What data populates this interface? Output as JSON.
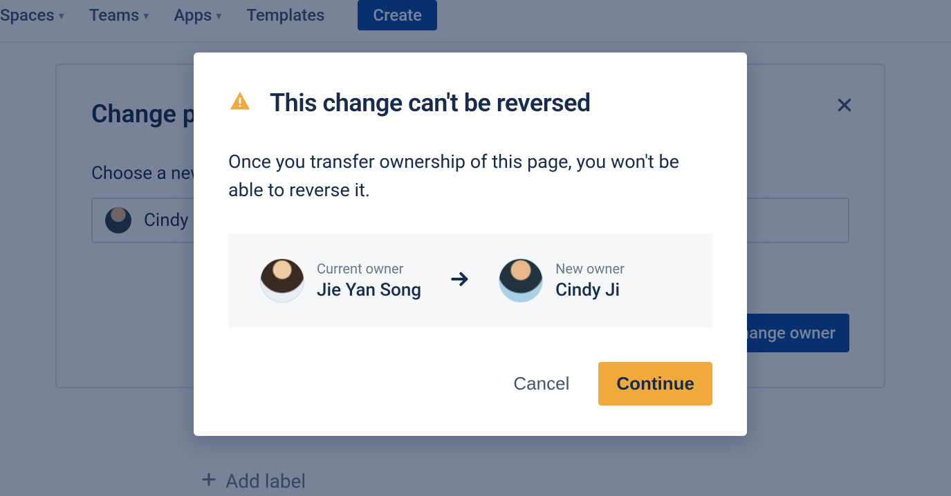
{
  "nav": {
    "items": [
      "Spaces",
      "Teams",
      "Apps",
      "Templates"
    ],
    "create": "Create"
  },
  "bgPanel": {
    "title": "Change page owner",
    "chooseLabel": "Choose a new owner",
    "selected": "Cindy Ji",
    "changeBtn": "Change owner"
  },
  "addLabel": "Add label",
  "modal": {
    "title": "This change can't be reversed",
    "description": "Once you transfer ownership of this page, you won't be able to reverse it.",
    "currentLabel": "Current owner",
    "currentName": "Jie Yan Song",
    "newLabel": "New owner",
    "newName": "Cindy Ji",
    "cancel": "Cancel",
    "continue": "Continue"
  },
  "colors": {
    "primary": "#0747a6",
    "warning": "#f2a93b",
    "text": "#172b4d",
    "muted": "#6b778c"
  }
}
